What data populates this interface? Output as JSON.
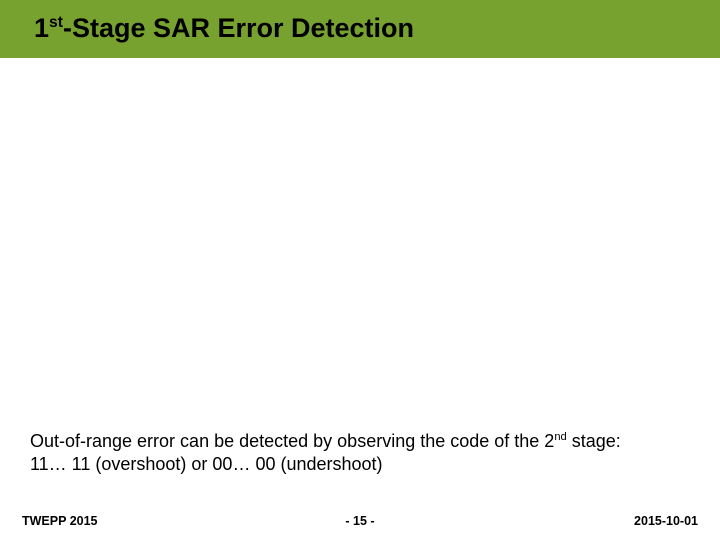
{
  "title": {
    "pre": "1",
    "sup1": "st",
    "rest": "-Stage SAR Error Detection"
  },
  "body": {
    "line1_pre": "Out-of-range error can be detected by observing the code of the 2",
    "line1_sup": "nd",
    "line1_post": " stage:",
    "line2": "11… 11 (overshoot) or 00… 00 (undershoot)"
  },
  "footer": {
    "left": "TWEPP 2015",
    "center": "- 15 -",
    "right": "2015-10-01"
  }
}
